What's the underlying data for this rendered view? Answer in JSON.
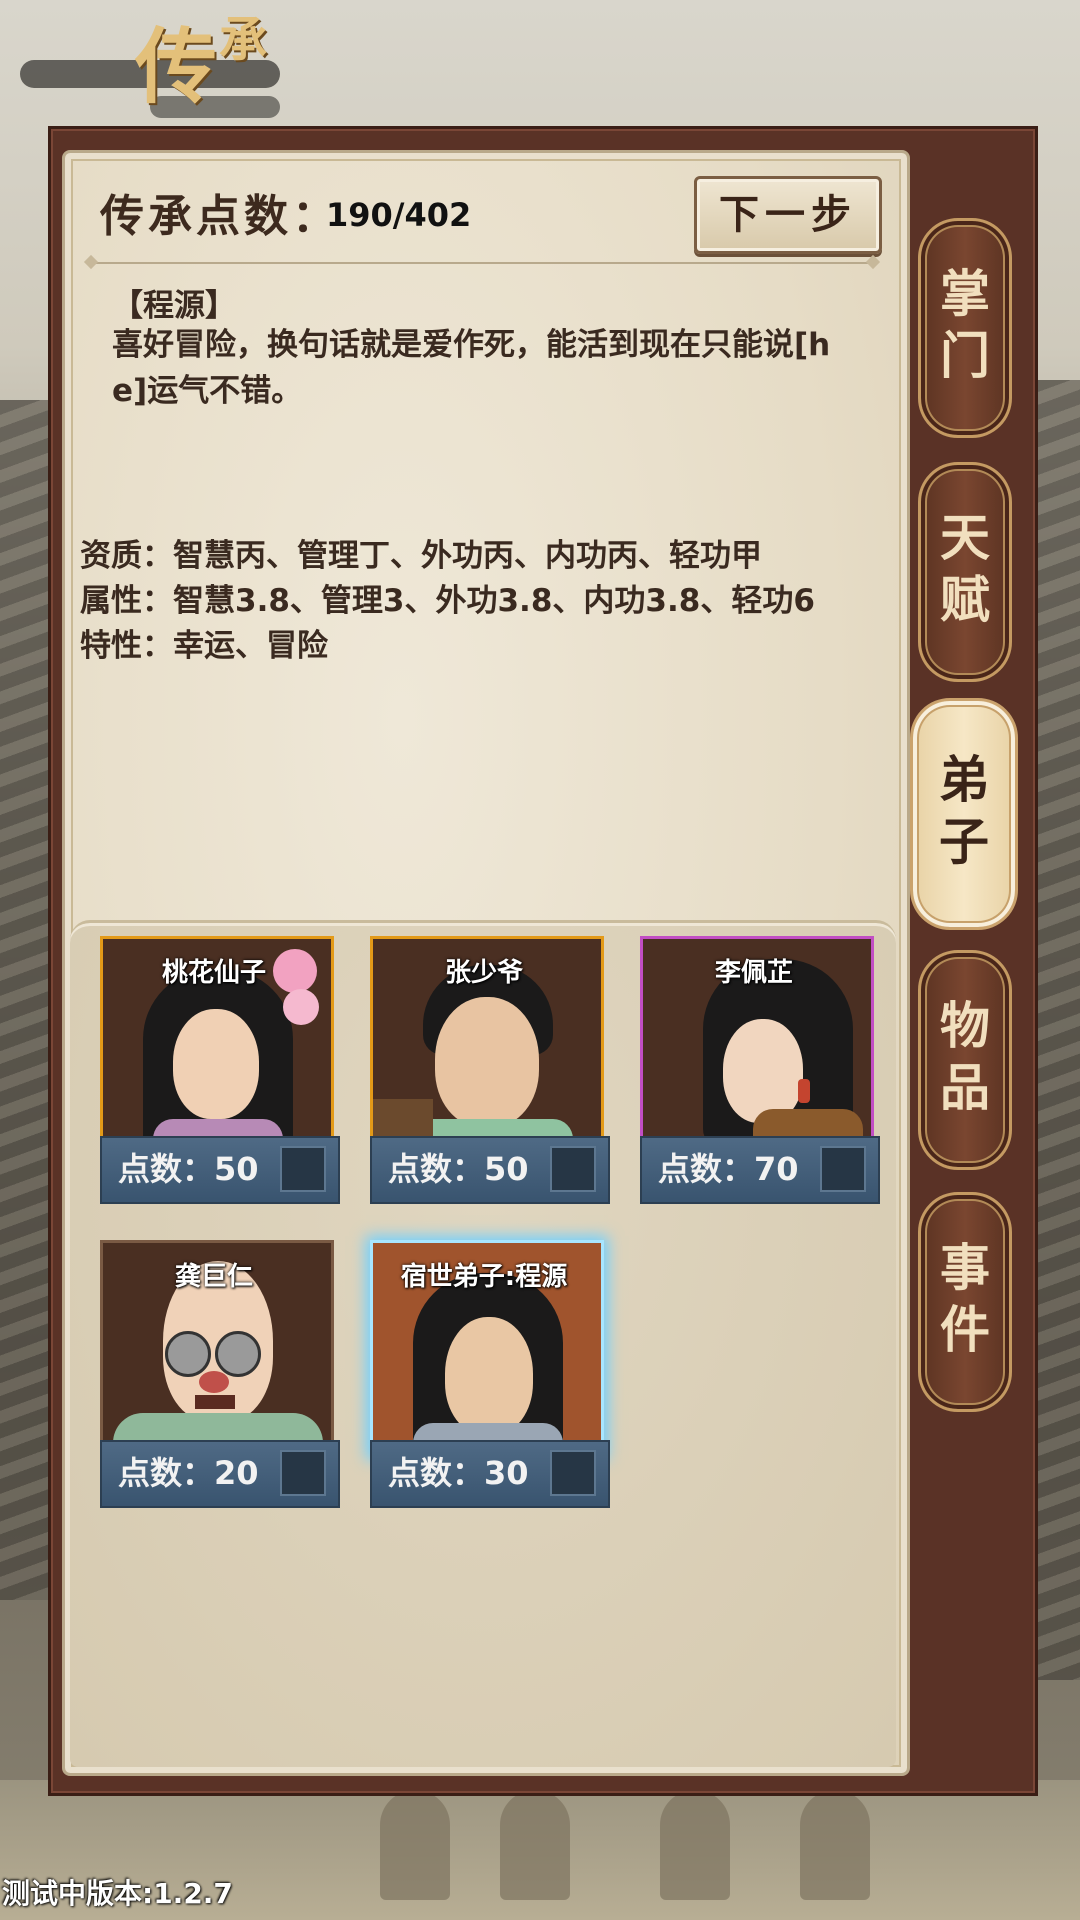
{
  "title": {
    "main": "传",
    "small": "承"
  },
  "header": {
    "points_label": "传承点数：",
    "points_value": "190/402",
    "next_button": "下一步"
  },
  "description": {
    "name": "【程源】",
    "text": "喜好冒险，换句话就是爱作死，能活到现在只能说[he]运气不错。"
  },
  "attributes": {
    "aptitude": "资质：智慧丙、管理丁、外功丙、内功丙、轻功甲",
    "stats": "属性：智慧3.8、管理3、外功3.8、内功3.8、轻功6",
    "traits": "特性：幸运、冒险"
  },
  "cards": [
    {
      "name": "桃花仙子",
      "points": "点数：50",
      "rarity": "gold"
    },
    {
      "name": "张少爷",
      "points": "点数：50",
      "rarity": "gold"
    },
    {
      "name": "李佩芷",
      "points": "点数：70",
      "rarity": "purple"
    },
    {
      "name": "龚巨仁",
      "points": "点数：20",
      "rarity": "brown"
    },
    {
      "name": "宿世弟子:程源",
      "points": "点数：30",
      "rarity": "selected"
    }
  ],
  "tabs": [
    {
      "label": "掌门"
    },
    {
      "label": "天赋"
    },
    {
      "label": "弟子",
      "active": true
    },
    {
      "label": "物品"
    },
    {
      "label": "事件"
    }
  ],
  "version": "测试中版本:1.2.7",
  "colors": {
    "panel": "#5a3226",
    "paper": "#e6dcc6",
    "gold_frame": "#e39a18",
    "purple_frame": "#c24ec4",
    "selected_glow": "#6fd0ff",
    "points_bar": "#4f6a85"
  }
}
